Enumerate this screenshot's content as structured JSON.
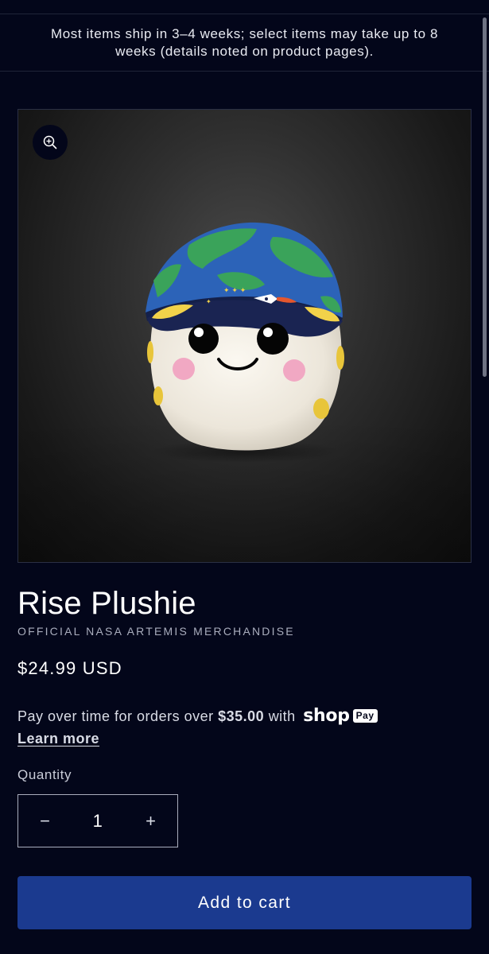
{
  "announcement": {
    "text": "Most items ship in 3–4 weeks; select items may take up to 8 weeks (details noted on product pages)."
  },
  "product": {
    "title": "Rise Plushie",
    "vendor": "OFFICIAL NASA ARTEMIS MERCHANDISE",
    "price": "$24.99 USD",
    "image_subject": "white moon plushie with blue-green Earth cap, yellow spots and smiling face"
  },
  "installments": {
    "prefix": "Pay over time for orders over",
    "threshold": "$35.00",
    "suffix": "with",
    "shop_word": "shop",
    "pay_word": "Pay",
    "learn_more": "Learn more"
  },
  "quantity": {
    "label": "Quantity",
    "value": "1",
    "decrease_symbol": "−",
    "increase_symbol": "+"
  },
  "cart": {
    "add_label": "Add to cart"
  },
  "icons": {
    "zoom": "zoom-in-icon",
    "minus": "minus-icon",
    "plus": "plus-icon"
  },
  "colors": {
    "background": "#03061a",
    "button": "#1b3a8f",
    "text": "#ffffff",
    "muted": "#a9adbd"
  }
}
